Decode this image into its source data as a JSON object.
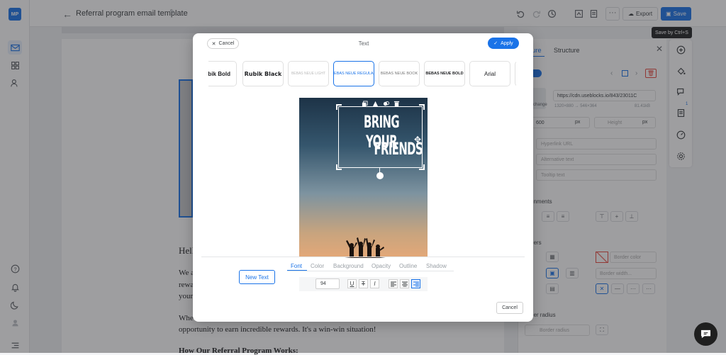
{
  "app": {
    "logo": "MP"
  },
  "header": {
    "title": "Referral program email template",
    "export_label": "Export",
    "save_label": "Save",
    "save_tooltip": "Save by Ctrl+S"
  },
  "email": {
    "greeting": "Hell",
    "para1_line1": "We a",
    "para1_line2": "rewa",
    "para1_line3": "your",
    "para2_line1": "Whe",
    "para2_line2": "opportunity to earn incredible rewards. It's a win-win situation!",
    "para3": "How Our Referral Program Works:"
  },
  "panel": {
    "tab1": "ture",
    "tab2": "Structure",
    "url": "https://cdn.useblocks.io/843/23011C",
    "dims": "1320×880 → 546×364",
    "size": "81.41kB",
    "change": "change",
    "width": "600",
    "width_unit": "px",
    "height_placeholder": "Height",
    "height_unit": "px",
    "hyperlink_placeholder": "Hyperlink URL",
    "alt_placeholder": "Alternative text",
    "tooltip_placeholder": "Tooltip text",
    "alignments_label": "gnments",
    "borders_label": "ders",
    "border_color_placeholder": "Border color",
    "border_width_placeholder": "Border width...",
    "radius_label": "der radius",
    "radius_placeholder": "Border radius",
    "notification_count": "1"
  },
  "modal": {
    "title": "Text",
    "cancel_top": "Cancel",
    "apply": "Apply",
    "fonts": [
      "ubik Bold",
      "Rubik Black",
      "BEBAS NEUE LIGHT",
      "BEBAS NEUE REGULAR",
      "BEBAS NEUE BOOK",
      "BEBAS NEUE BOLD",
      "Arial"
    ],
    "selected_font_index": 3,
    "canvas_text_line1": "BRING YOUR",
    "canvas_text_line2": "FRIENDS",
    "editor_tabs": [
      "Font",
      "Color",
      "Background",
      "Opacity",
      "Outline",
      "Shadow"
    ],
    "active_tab": "Font",
    "new_text": "New Text",
    "font_size": "94",
    "format_buttons": {
      "underline": "U",
      "strike": "T",
      "italic": "I"
    },
    "cancel_bottom": "Cancel"
  },
  "colors": {
    "accent": "#1a73e8",
    "dark": "#202124",
    "overlay": "rgba(40,40,45,0.45)"
  }
}
